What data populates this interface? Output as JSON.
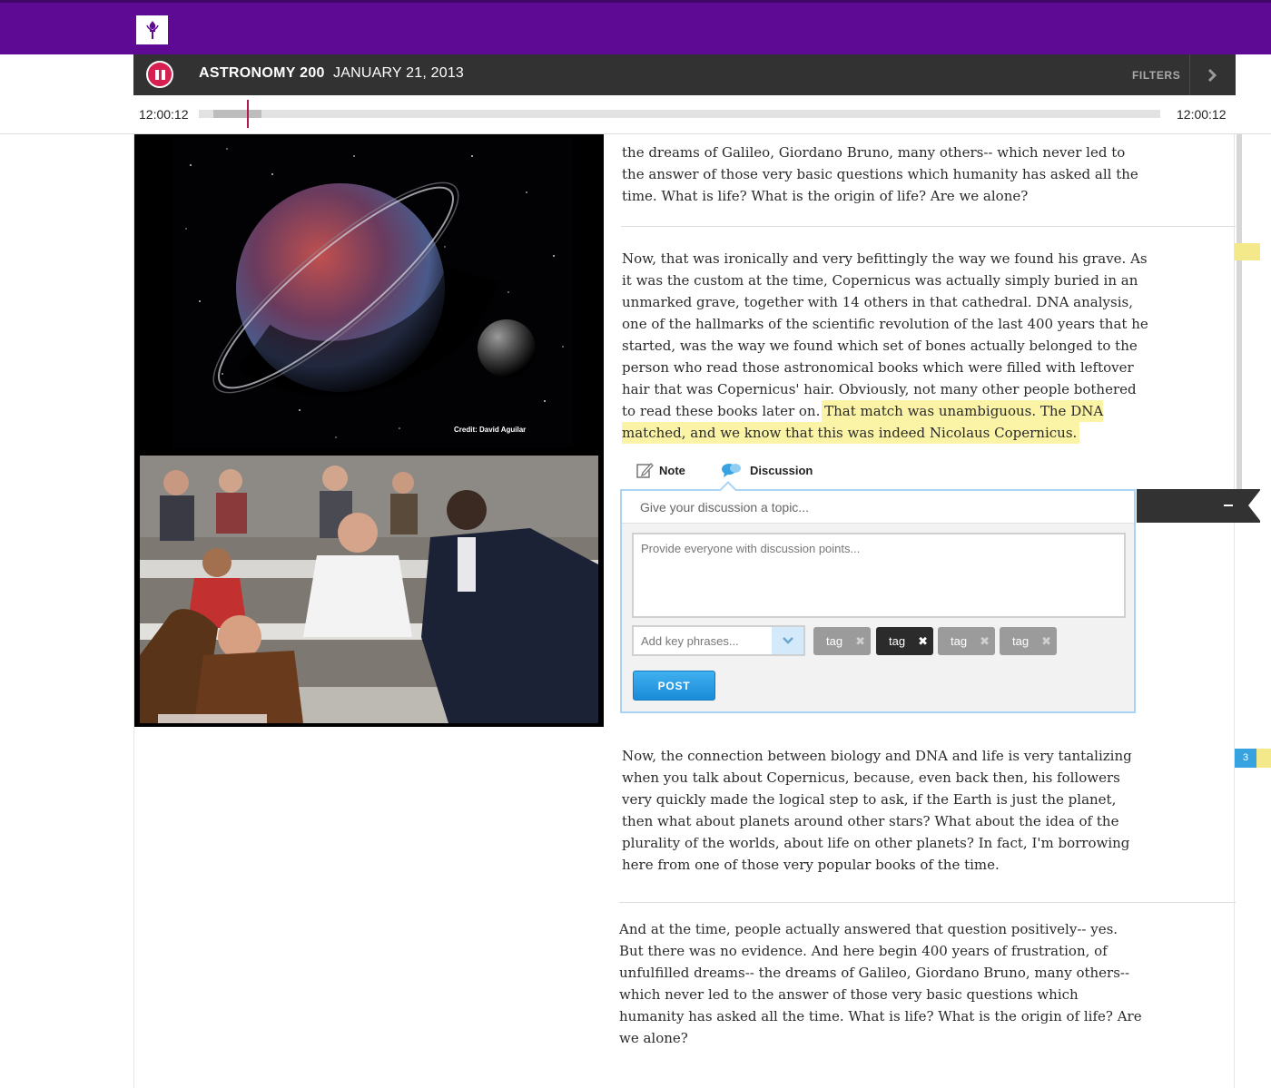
{
  "brand": {
    "logo_icon": "nyu-torch-icon",
    "bar_color": "#5e0a95"
  },
  "course": {
    "title": "ASTRONOMY 200",
    "date": "JANUARY 21, 2013",
    "filters_label": "FILTERS",
    "accent": "#d6204f"
  },
  "player": {
    "time_current": "12:00:12",
    "time_total": "12:00:12",
    "progress": 0.05
  },
  "media": {
    "space_credit": "Credit: David Aguilar",
    "space_icon": "planet-illustration",
    "classroom_icon": "classroom-photo"
  },
  "transcript": {
    "p1": "the dreams of Galileo, Giordano Bruno, many others-- which never led to the answer of those very basic questions which humanity has asked all the time. What is life? What is the origin of life? Are we alone?",
    "p2_plain": "Now, that was ironically and very befittingly the way we found his grave. As it was the custom at the time, Copernicus was actually simply buried in an unmarked grave, together with 14 others in that cathedral. DNA analysis, one of the hallmarks of the scientific revolution of the last 400 years that he started, was the way we found which set of bones actually belonged to the person who read those astronomical books which were filled with leftover hair that was Copernicus' hair. Obviously, not many other people bothered to read these books later on.",
    "p2_highlight": "That match was unambiguous. The DNA matched, and we know that this was indeed Nicolaus Copernicus.",
    "p3": "Now, the connection between biology and DNA and life is very tantalizing when you talk about Copernicus, because, even back then, his followers very quickly made the logical step to ask, if the Earth is just the planet, then what about planets around other stars? What about the idea of the plurality of the worlds, about life on other planets? In fact, I'm borrowing here from one of those very popular books of the time.",
    "p4": "And at the time, people actually answered that question positively-- yes. But there was no evidence. And here begin 400 years of frustration, of unfulfilled dreams-- the dreams of Galileo, Giordano Bruno, many others-- which never led to the answer of those very basic questions which humanity has asked all the time. What is life? What is the origin of life? Are we alone?",
    "highlight_color": "#fbf4a6"
  },
  "annotation": {
    "tabs": [
      {
        "label": "Note",
        "icon": "note-edit-icon"
      },
      {
        "label": "Discussion",
        "icon": "speech-bubbles-icon"
      }
    ],
    "topic_placeholder": "Give your discussion a topic...",
    "points_placeholder": "Provide everyone with discussion points...",
    "key_placeholder": "Add key phrases...",
    "tags": [
      {
        "label": "tag",
        "style": "grey"
      },
      {
        "label": "tag",
        "style": "dark"
      },
      {
        "label": "tag",
        "style": "grey"
      },
      {
        "label": "tag",
        "style": "grey"
      }
    ],
    "post_label": "POST"
  },
  "margin": {
    "discussion_count": "3",
    "marker_color": "#f3e98a",
    "count_color": "#36a3e0"
  }
}
